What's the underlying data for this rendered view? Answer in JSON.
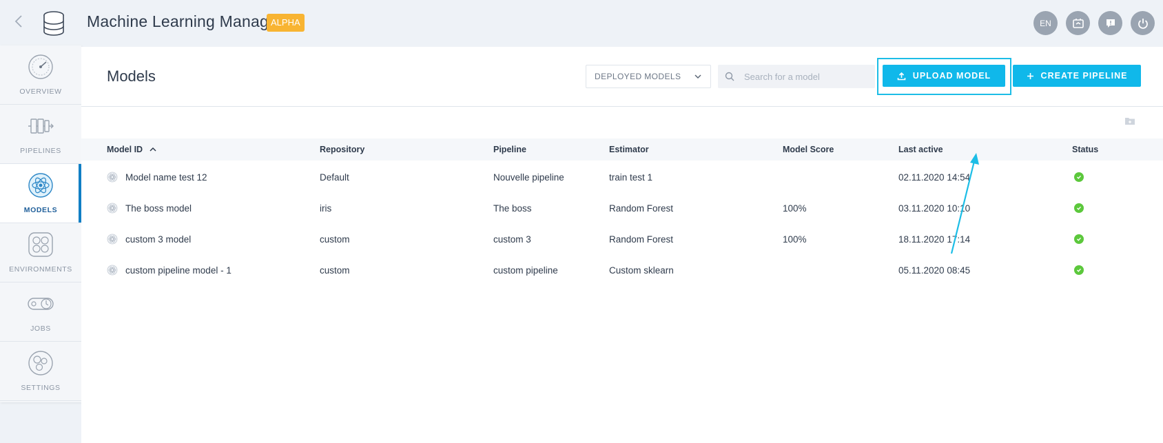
{
  "topbar": {
    "title": "Machine Learning Manager",
    "badge": "ALPHA",
    "language": "EN"
  },
  "sidebar": {
    "items": [
      {
        "label": "OVERVIEW",
        "icon": "gauge-icon"
      },
      {
        "label": "PIPELINES",
        "icon": "pipeline-icon"
      },
      {
        "label": "MODELS",
        "icon": "atom-icon",
        "active": true
      },
      {
        "label": "ENVIRONMENTS",
        "icon": "environments-icon"
      },
      {
        "label": "JOBS",
        "icon": "jobs-icon"
      },
      {
        "label": "SETTINGS",
        "icon": "settings-gear-icon"
      }
    ]
  },
  "main": {
    "title": "Models",
    "filter": "DEPLOYED MODELS",
    "search_placeholder": "Search for a model",
    "upload_label": "UPLOAD MODEL",
    "create_label": "CREATE PIPELINE"
  },
  "table": {
    "columns": [
      "Model ID",
      "Repository",
      "Pipeline",
      "Estimator",
      "Model Score",
      "Last active",
      "Status"
    ],
    "rows": [
      {
        "model_id": "Model name test 12",
        "repository": "Default",
        "pipeline": "Nouvelle pipeline",
        "estimator": "train test 1",
        "score": "",
        "last_active": "02.11.2020 14:54",
        "status": "ok"
      },
      {
        "model_id": "The boss model",
        "repository": "iris",
        "pipeline": "The boss",
        "estimator": "Random Forest",
        "score": "100%",
        "last_active": "03.11.2020 10:10",
        "status": "ok"
      },
      {
        "model_id": "custom 3 model",
        "repository": "custom",
        "pipeline": "custom 3",
        "estimator": "Random Forest",
        "score": "100%",
        "last_active": "18.11.2020 17:14",
        "status": "ok"
      },
      {
        "model_id": "custom pipeline model - 1",
        "repository": "custom",
        "pipeline": "custom pipeline",
        "estimator": "Custom sklearn",
        "score": "",
        "last_active": "05.11.2020 08:45",
        "status": "ok"
      }
    ]
  },
  "colors": {
    "accent": "#10b8ea",
    "highlight": "#1cbde6",
    "badge": "#f8b432",
    "active_bar": "#117fc5",
    "status_ok": "#5cc83c"
  }
}
